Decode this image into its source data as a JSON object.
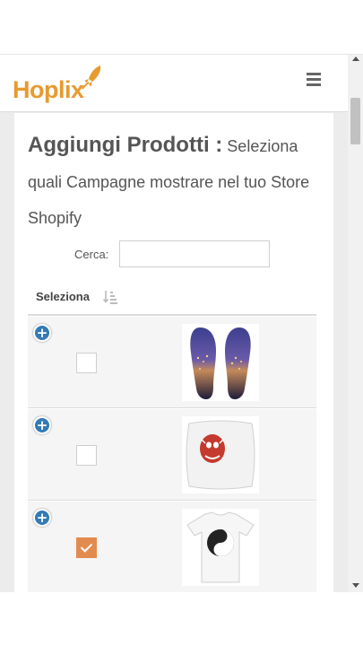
{
  "header": {
    "logo_text": "Hoplix",
    "brand_color": "#e79a2f",
    "menu_icon": "hamburger-icon"
  },
  "page": {
    "title_bold": "Aggiungi Prodotti :",
    "title_rest": "Seleziona quali Campagne mostrare nel tuo Store Shopify"
  },
  "search": {
    "label": "Cerca:",
    "value": ""
  },
  "table": {
    "column_header": "Seleziona",
    "sort_icon": "sort-amount-icon",
    "rows": [
      {
        "product": "flip-flops",
        "checked": false
      },
      {
        "product": "pillow",
        "checked": false
      },
      {
        "product": "t-shirt",
        "checked": true
      }
    ]
  },
  "colors": {
    "accent_check": "#e38b4f",
    "expand_button": "#337ab7"
  }
}
